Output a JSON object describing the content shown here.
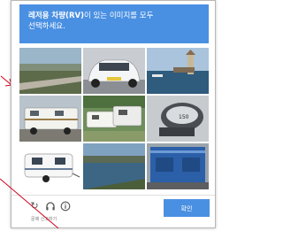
{
  "captcha": {
    "prompt_bold": "레저용 차량(RV)",
    "prompt_rest_1": "이 있는 이미지를 모두",
    "prompt_line2": "선택하세요.",
    "tiles": [
      {
        "name": "tile-road-landscape",
        "subject": "road-landscape"
      },
      {
        "name": "tile-white-car",
        "subject": "white-car"
      },
      {
        "name": "tile-harbor",
        "subject": "harbor"
      },
      {
        "name": "tile-motorhome",
        "subject": "motorhome"
      },
      {
        "name": "tile-rv-campground",
        "subject": "rv-campground"
      },
      {
        "name": "tile-boat-motor",
        "subject": "boat-motor"
      },
      {
        "name": "tile-caravan-trailer",
        "subject": "caravan-trailer"
      },
      {
        "name": "tile-lake",
        "subject": "lake"
      },
      {
        "name": "tile-blue-truck",
        "subject": "blue-truck"
      }
    ],
    "footer": {
      "reload_icon": "reload-icon",
      "audio_icon": "headphones-icon",
      "info_icon": "info-icon",
      "report_text": "문제 신고하기",
      "verify_label": "확인"
    },
    "colors": {
      "accent": "#4a90e2",
      "arrow": "#d0021b"
    }
  }
}
